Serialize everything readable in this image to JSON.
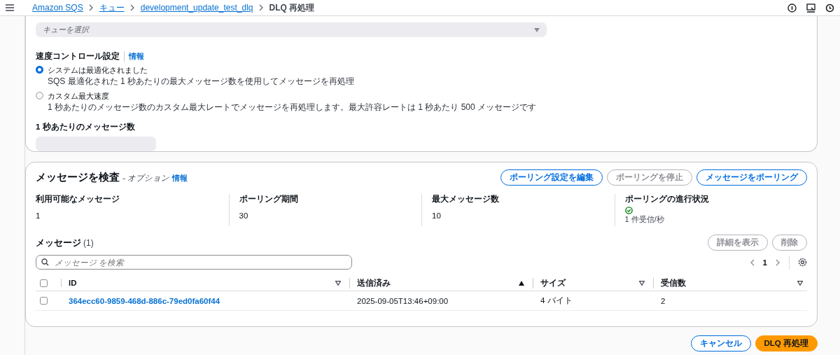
{
  "breadcrumbs": [
    {
      "label": "Amazon SQS",
      "link": true
    },
    {
      "label": "キュー",
      "link": true
    },
    {
      "label": "development_update_test_dlq",
      "link": true
    },
    {
      "label": "DLQ 再処理",
      "link": false
    }
  ],
  "queue_select": {
    "placeholder": "キューを選択"
  },
  "speed_control": {
    "label": "速度コントロール設定",
    "info": "情報",
    "options": [
      {
        "label": "システムは最適化されました",
        "description": "SQS 最適化された 1 秒あたりの最大メッセージ数を使用してメッセージを再処理",
        "selected": true
      },
      {
        "label": "カスタム最大速度",
        "description": "1 秒あたりのメッセージ数のカスタム最大レートでメッセージを再処理します。最大許容レートは 1 秒あたり 500 メッセージです",
        "selected": false
      }
    ]
  },
  "rate_field": {
    "label": "1 秒あたりのメッセージ数",
    "disabled": true
  },
  "inspect": {
    "title": "メッセージを検査",
    "suffix": "- オプション",
    "info": "情報",
    "buttons": [
      {
        "label": "ポーリング設定を編集",
        "disabled": false
      },
      {
        "label": "ポーリングを停止",
        "disabled": true
      },
      {
        "label": "メッセージをポーリング",
        "disabled": false
      }
    ],
    "stats": [
      {
        "label": "利用可能なメッセージ",
        "value": "1"
      },
      {
        "label": "ポーリング期間",
        "value": "30"
      },
      {
        "label": "最大メッセージ数",
        "value": "10"
      },
      {
        "label": "ポーリングの進行状況",
        "value": "1 件受信/秒",
        "kind": "progress"
      }
    ]
  },
  "messages": {
    "title": "メッセージ",
    "count": "(1)",
    "buttons": [
      {
        "label": "詳細を表示",
        "disabled": true
      },
      {
        "label": "削除",
        "disabled": true
      }
    ],
    "search": {
      "placeholder": "メッセージ を検索"
    },
    "page": "1",
    "columns": [
      {
        "label": "ID",
        "sorted": false
      },
      {
        "label": "送信済み",
        "sorted": true
      },
      {
        "label": "サイズ",
        "sorted": false
      },
      {
        "label": "受信数",
        "sorted": false
      }
    ],
    "header_checked": false,
    "rows": [
      {
        "checked": false,
        "cells": [
          "364ecc60-9859-468d-886c-79ed0fa60f44",
          "2025-09-05T13:46+09:00",
          "4 バイト",
          "2"
        ]
      }
    ]
  },
  "footer": {
    "cancel": "キャンセル",
    "submit": "DLQ 再処理"
  }
}
